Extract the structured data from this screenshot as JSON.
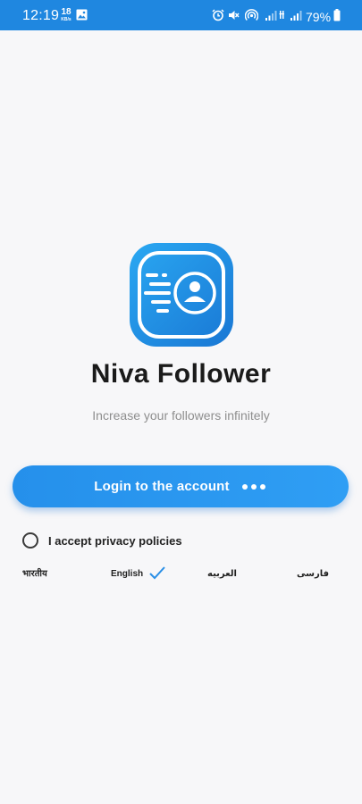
{
  "status_bar": {
    "time": "12:19",
    "net_speed": "18",
    "net_unit": "KB/s",
    "battery": "79%",
    "icons": [
      "image-icon",
      "alarm-icon",
      "mute-icon",
      "hotspot-icon",
      "signal-icon",
      "signal-icon",
      "battery-icon"
    ],
    "color": "#1f87e0"
  },
  "app": {
    "title": "Niva Follower",
    "subtitle": "Increase your followers infinitely",
    "accent_color": "#2590eb"
  },
  "login_button": {
    "label": "Login to the account"
  },
  "privacy": {
    "label": "I accept privacy policies",
    "checked": false
  },
  "languages": {
    "items": [
      {
        "label": "भारतीय",
        "selected": false
      },
      {
        "label": "English",
        "selected": true
      },
      {
        "label": "العربیه",
        "selected": false
      },
      {
        "label": "فارسی",
        "selected": false
      }
    ]
  }
}
